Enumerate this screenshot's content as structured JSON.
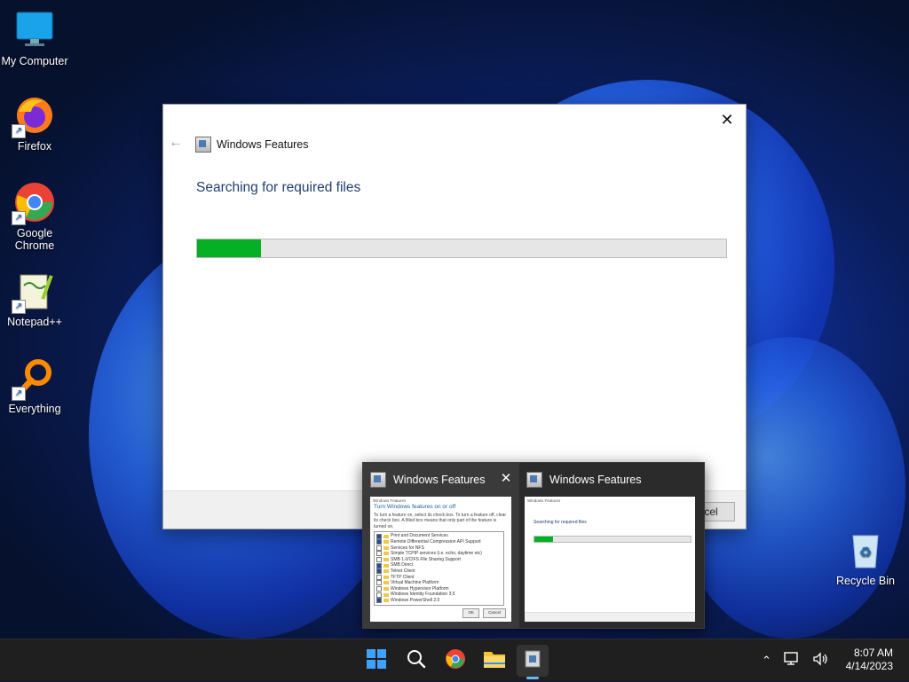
{
  "desktop": {
    "icons": [
      {
        "label": "My Computer",
        "icon": "monitor-icon"
      },
      {
        "label": "Firefox",
        "icon": "firefox-icon"
      },
      {
        "label": "Google Chrome",
        "icon": "chrome-icon"
      },
      {
        "label": "Notepad++",
        "icon": "notepadpp-icon"
      },
      {
        "label": "Everything",
        "icon": "everything-icon"
      },
      {
        "label": "Recycle Bin",
        "icon": "recycle-bin-icon"
      }
    ]
  },
  "dialog": {
    "title": "Windows Features",
    "heading": "Searching for required files",
    "progress_fraction": 0.12,
    "cancel_label": "Cancel",
    "colors": {
      "progress": "#06b025",
      "heading": "#1f3f6f"
    }
  },
  "preview": {
    "thumbnails": [
      {
        "title": "Windows Features",
        "mini_heading": "Windows Features",
        "mini_title": "Turn Windows features on or off",
        "mini_desc": "To turn a feature on, select its check box. To turn a feature off, clear its check box. A filled box means that only part of the feature is turned on.",
        "features": [
          {
            "name": "Print and Document Services",
            "state": "partial"
          },
          {
            "name": "Remote Differential Compression API Support",
            "state": "on"
          },
          {
            "name": "Services for NFS",
            "state": "off"
          },
          {
            "name": "Simple TCPIP services (i.e. echo, daytime etc)",
            "state": "off"
          },
          {
            "name": "SMB 1.0/CIFS File Sharing Support",
            "state": "off"
          },
          {
            "name": "SMB Direct",
            "state": "on"
          },
          {
            "name": "Telnet Client",
            "state": "on"
          },
          {
            "name": "TFTP Client",
            "state": "off"
          },
          {
            "name": "Virtual Machine Platform",
            "state": "off"
          },
          {
            "name": "Windows Hypervisor Platform",
            "state": "off"
          },
          {
            "name": "Windows Identity Foundation 3.5",
            "state": "off"
          },
          {
            "name": "Windows PowerShell 2.0",
            "state": "on"
          }
        ],
        "ok_label": "OK",
        "cancel_label": "Cancel"
      },
      {
        "title": "Windows Features",
        "mini_heading": "Windows Features",
        "mini_search": "Searching for required files"
      }
    ]
  },
  "taskbar": {
    "apps": [
      "start-icon",
      "search-icon",
      "chrome-icon",
      "file-explorer-icon",
      "windows-features-icon"
    ],
    "time": "8:07 AM",
    "date": "4/14/2023"
  }
}
